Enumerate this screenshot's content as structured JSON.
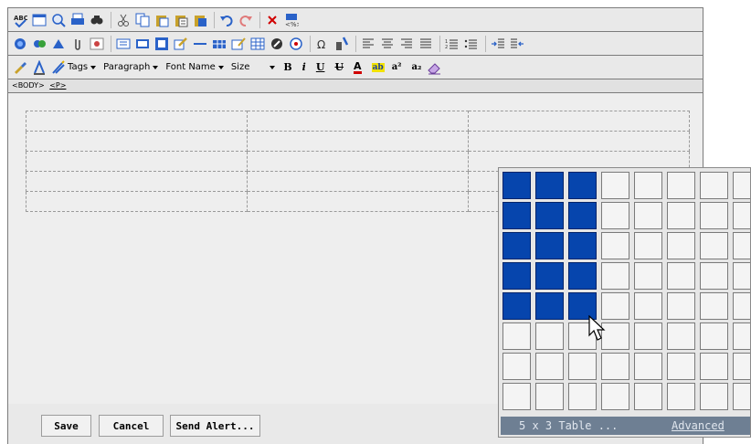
{
  "toolbar": {
    "row1_icons": [
      "spellcheck-icon",
      "preview-icon",
      "zoom-icon",
      "print-icon",
      "find-icon",
      "cut-icon",
      "copy-icon",
      "paste-icon",
      "paste-text-icon",
      "paste-word-icon",
      "undo-icon",
      "redo-icon",
      "remove-format-icon",
      "insert-tag-icon"
    ],
    "row2_icons": [
      "special-link-icon",
      "anchor-icon",
      "bookmark-icon",
      "attachment-icon",
      "image-manager-icon",
      "form-text-icon",
      "form-field-icon",
      "form-checkbox-icon",
      "widget-icon",
      "horizontal-rule-icon",
      "table-insert-icon",
      "table-props-icon",
      "table-cells-icon",
      "flash-icon",
      "media-icon",
      "special-char-icon",
      "symbol-icon",
      "align-left-icon",
      "align-center-icon",
      "align-right-icon",
      "align-justify-icon",
      "ordered-list-icon",
      "unordered-list-icon",
      "indent-icon",
      "outdent-icon"
    ],
    "row3": {
      "tags_label": "Tags",
      "paragraph_label": "Paragraph",
      "font_label": "Font Name",
      "size_label": "Size",
      "bold": "B",
      "italic": "i",
      "underline": "U",
      "strike": "U",
      "font_color": "A",
      "highlight": "ab",
      "superscript": "a²",
      "subscript": "a₂"
    }
  },
  "pathbar": {
    "body_tag": "<BODY>",
    "p_tag": "<P>"
  },
  "footer": {
    "save_label": "Save",
    "cancel_label": "Cancel",
    "send_alert_label": "Send Alert..."
  },
  "table_picker": {
    "selected_cols": 3,
    "selected_rows": 5,
    "size_text": "5 x 3 Table ...",
    "advanced_text": "Advanced"
  },
  "colors": {
    "selected_cell": "#0645ad",
    "status_bar": "#6e7f93",
    "frame": "#7b7b7b"
  }
}
